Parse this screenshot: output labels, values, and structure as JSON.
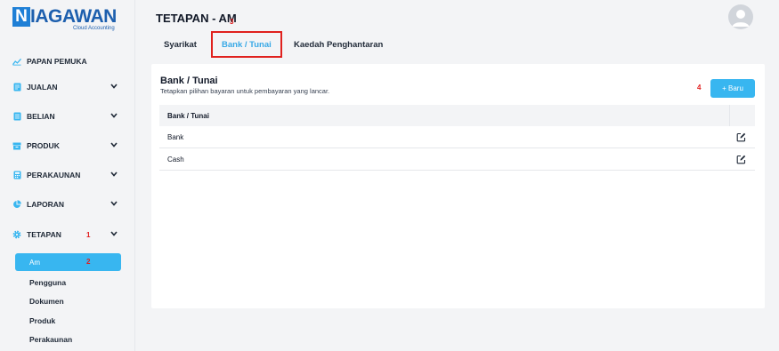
{
  "brand": {
    "logo_initial": "N",
    "logo_text": "IAGAWAN",
    "logo_subtitle": "Cloud Accounting"
  },
  "sidebar": {
    "items": [
      {
        "label": "PAPAN PEMUKA",
        "icon": "chart-line-icon"
      },
      {
        "label": "JUALAN",
        "icon": "receipt-icon"
      },
      {
        "label": "BELIAN",
        "icon": "document-icon"
      },
      {
        "label": "PRODUK",
        "icon": "box-icon"
      },
      {
        "label": "PERAKAUNAN",
        "icon": "calculator-icon"
      },
      {
        "label": "LAPORAN",
        "icon": "pie-chart-icon"
      },
      {
        "label": "TETAPAN",
        "icon": "gear-icon"
      }
    ],
    "tetapan_badge": "1",
    "subitems": [
      {
        "label": "Am",
        "active": true,
        "badge": "2"
      },
      {
        "label": "Pengguna"
      },
      {
        "label": "Dokumen"
      },
      {
        "label": "Produk"
      },
      {
        "label": "Perakaunan"
      }
    ]
  },
  "header": {
    "title": "TETAPAN - AM",
    "title_badge": "3"
  },
  "tabs": [
    {
      "label": "Syarikat"
    },
    {
      "label": "Bank / Tunai",
      "active": true
    },
    {
      "label": "Kaedah Penghantaran"
    }
  ],
  "card": {
    "title": "Bank / Tunai",
    "subtitle": "Tetapkan pilihan bayaran untuk pembayaran yang lancar.",
    "new_button": "+ Baru",
    "new_button_badge": "4"
  },
  "table": {
    "header": "Bank / Tunai",
    "rows": [
      "Bank",
      "Cash"
    ]
  },
  "colors": {
    "accent": "#38b6f0",
    "highlight_border": "#e0211e",
    "badge": "#e11d1d",
    "brand": "#1d5fae"
  }
}
